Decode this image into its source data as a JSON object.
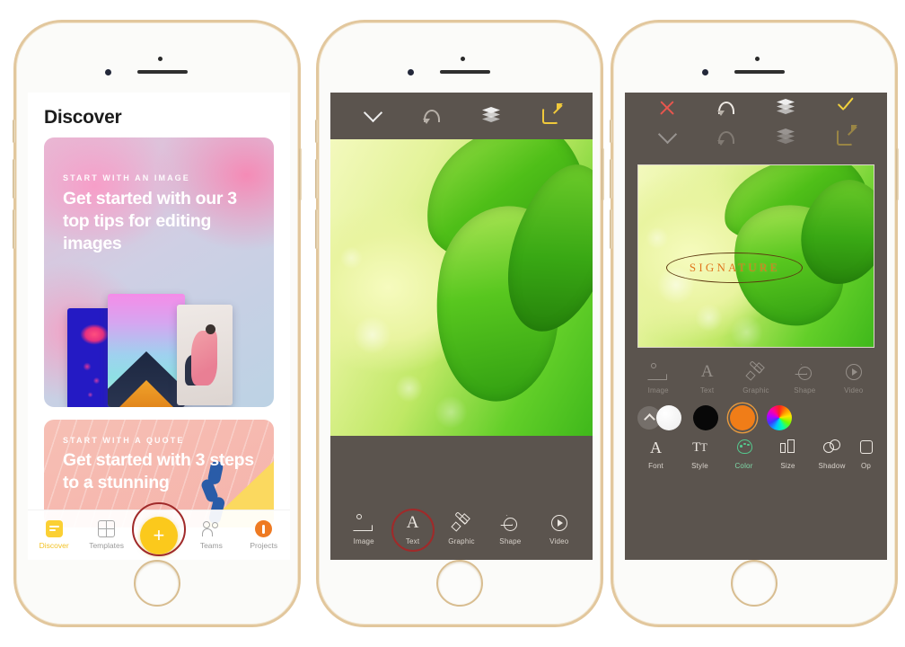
{
  "app": {
    "device": "iPhone",
    "frame_color": "#e2c79d",
    "accent_yellow": "#fbc91c",
    "editor_bg": "#5b544e"
  },
  "phone1": {
    "screen_name": "discover",
    "header": {
      "title": "Discover"
    },
    "cards": [
      {
        "kicker": "START WITH AN IMAGE",
        "title": "Get started with our 3 top tips for editing images",
        "thumbnails": [
          "jellyfish-thumbnail",
          "building-thumbnail",
          "dancer-thumbnail"
        ]
      },
      {
        "kicker": "START WITH A QUOTE",
        "title": "Get started with 3 steps to a stunning"
      }
    ],
    "tabbar": {
      "items": [
        {
          "label": "Discover",
          "icon": "discover-icon",
          "active": true
        },
        {
          "label": "Templates",
          "icon": "grid-icon",
          "active": false
        },
        {
          "label": "Teams",
          "icon": "people-icon",
          "active": false
        },
        {
          "label": "Projects",
          "icon": "projects-icon",
          "active": false
        }
      ],
      "create_button_label": "+",
      "create_button_highlighted": true
    }
  },
  "phone2": {
    "screen_name": "editor",
    "toolbar": [
      {
        "icon": "chevron-down-icon",
        "name": "collapse",
        "state": "enabled"
      },
      {
        "icon": "undo-icon",
        "name": "undo",
        "state": "disabled"
      },
      {
        "icon": "layers-icon",
        "name": "layers",
        "state": "enabled"
      },
      {
        "icon": "export-icon",
        "name": "export",
        "state": "enabled"
      }
    ],
    "canvas": {
      "image": "green-leaves-bokeh"
    },
    "tools": [
      {
        "label": "Image",
        "icon": "image-icon",
        "selected": false
      },
      {
        "label": "Text",
        "icon": "text-icon",
        "selected": true
      },
      {
        "label": "Graphic",
        "icon": "graphic-icon",
        "selected": false
      },
      {
        "label": "Shape",
        "icon": "shape-icon",
        "selected": false
      },
      {
        "label": "Video",
        "icon": "video-icon",
        "selected": false
      }
    ]
  },
  "phone3": {
    "screen_name": "text-editing",
    "toolbar_primary": [
      {
        "icon": "close-icon",
        "name": "cancel",
        "color": "#e8564e"
      },
      {
        "icon": "undo-icon",
        "name": "undo",
        "color": "#ffffff"
      },
      {
        "icon": "layers-icon",
        "name": "layers",
        "color": "#ffffff"
      },
      {
        "icon": "check-icon",
        "name": "confirm",
        "color": "#f2d23c"
      }
    ],
    "toolbar_secondary": [
      {
        "icon": "chevron-down-icon",
        "name": "collapse"
      },
      {
        "icon": "undo-icon",
        "name": "undo"
      },
      {
        "icon": "layers-icon",
        "name": "layers"
      },
      {
        "icon": "export-icon",
        "name": "export"
      }
    ],
    "canvas": {
      "image": "green-leaves-bokeh",
      "text_layer": {
        "text": "SIGNATURE",
        "color": "#e0761a",
        "outline_shape": "ellipse",
        "outline_color": "#5d3a10"
      }
    },
    "element_tools": [
      {
        "label": "Image",
        "icon": "image-icon"
      },
      {
        "label": "Text",
        "icon": "text-icon"
      },
      {
        "label": "Graphic",
        "icon": "graphic-icon"
      },
      {
        "label": "Shape",
        "icon": "shape-icon"
      },
      {
        "label": "Video",
        "icon": "video-icon"
      }
    ],
    "color_swatches": [
      {
        "name": "expand-toggle",
        "icon": "chevron-up-icon",
        "color": ""
      },
      {
        "name": "white-swatch",
        "color": "#ffffff",
        "selected": false
      },
      {
        "name": "black-swatch",
        "color": "#080808",
        "selected": false
      },
      {
        "name": "orange-swatch",
        "color": "#f07d18",
        "selected": true
      },
      {
        "name": "color-wheel",
        "color": "rainbow",
        "selected": false
      }
    ],
    "text_tools": [
      {
        "label": "Font",
        "icon": "font-icon",
        "active": false
      },
      {
        "label": "Style",
        "icon": "style-icon",
        "active": false
      },
      {
        "label": "Color",
        "icon": "palette-icon",
        "active": true
      },
      {
        "label": "Size",
        "icon": "size-icon",
        "active": false
      },
      {
        "label": "Shadow",
        "icon": "shadow-icon",
        "active": false
      },
      {
        "label": "Op",
        "icon": "opacity-icon",
        "active": false
      }
    ]
  }
}
